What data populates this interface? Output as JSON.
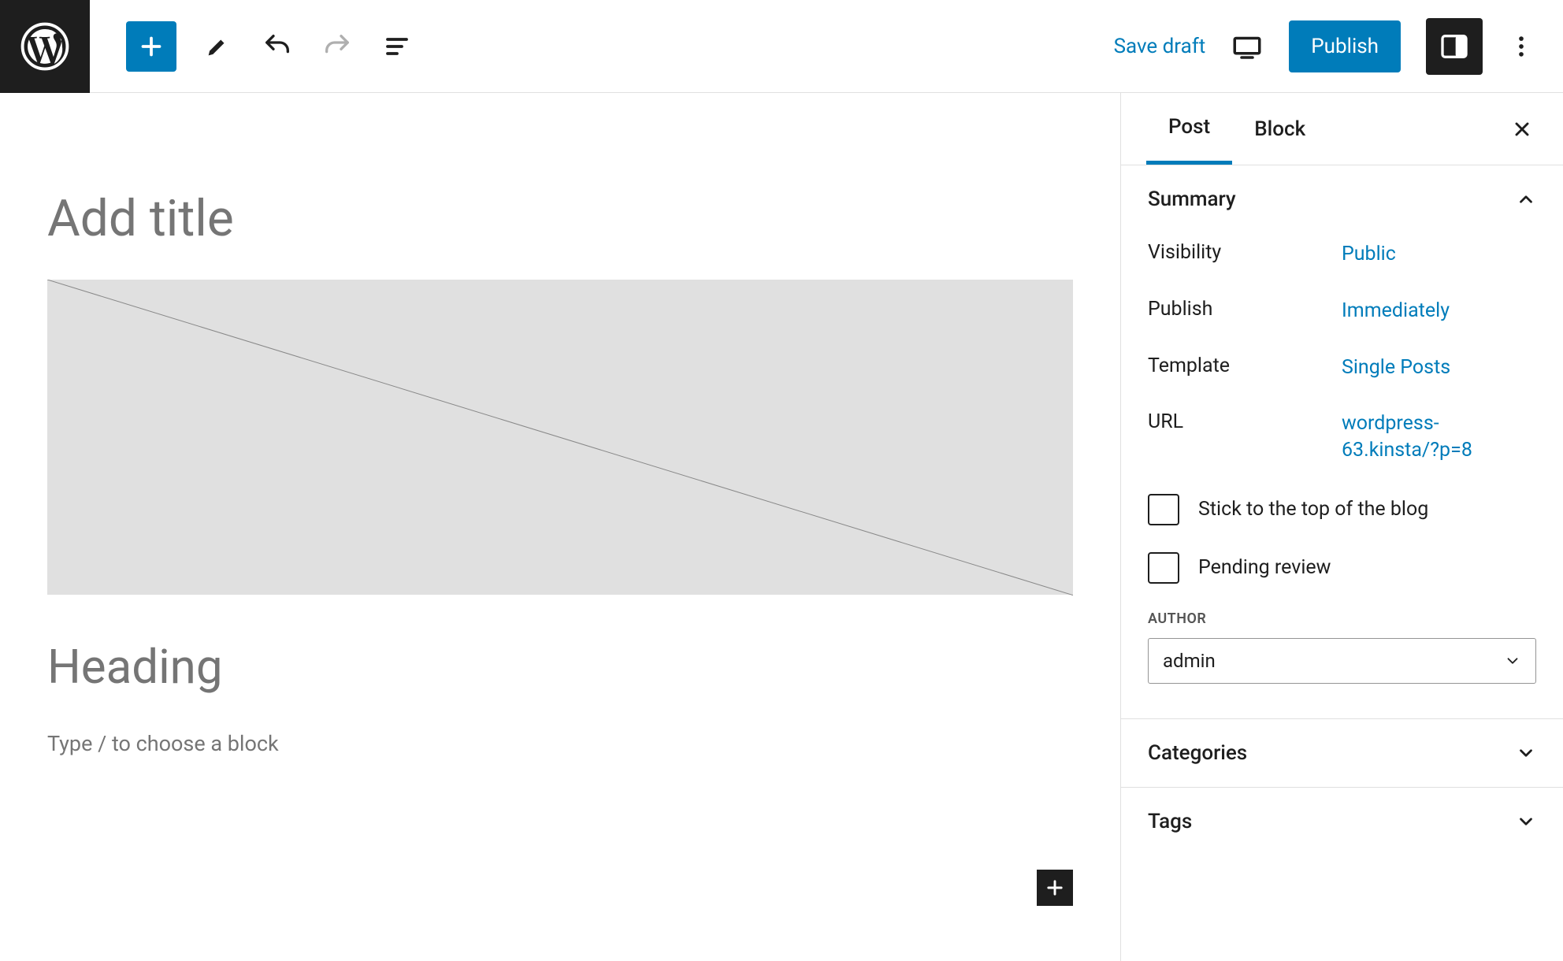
{
  "topbar": {
    "save_draft": "Save draft",
    "publish": "Publish"
  },
  "editor": {
    "title_placeholder": "Add title",
    "heading_placeholder": "Heading",
    "paragraph_placeholder": "Type / to choose a block"
  },
  "sidebar": {
    "tabs": {
      "post": "Post",
      "block": "Block"
    },
    "panels": {
      "summary": {
        "title": "Summary",
        "visibility_label": "Visibility",
        "visibility_value": "Public",
        "publish_label": "Publish",
        "publish_value": "Immediately",
        "template_label": "Template",
        "template_value": "Single Posts",
        "url_label": "URL",
        "url_value": "wordpress-63.kinsta/?p=8",
        "sticky_label": "Stick to the top of the blog",
        "pending_label": "Pending review",
        "author_heading": "AUTHOR",
        "author_value": "admin"
      },
      "categories": {
        "title": "Categories"
      },
      "tags": {
        "title": "Tags"
      }
    }
  }
}
